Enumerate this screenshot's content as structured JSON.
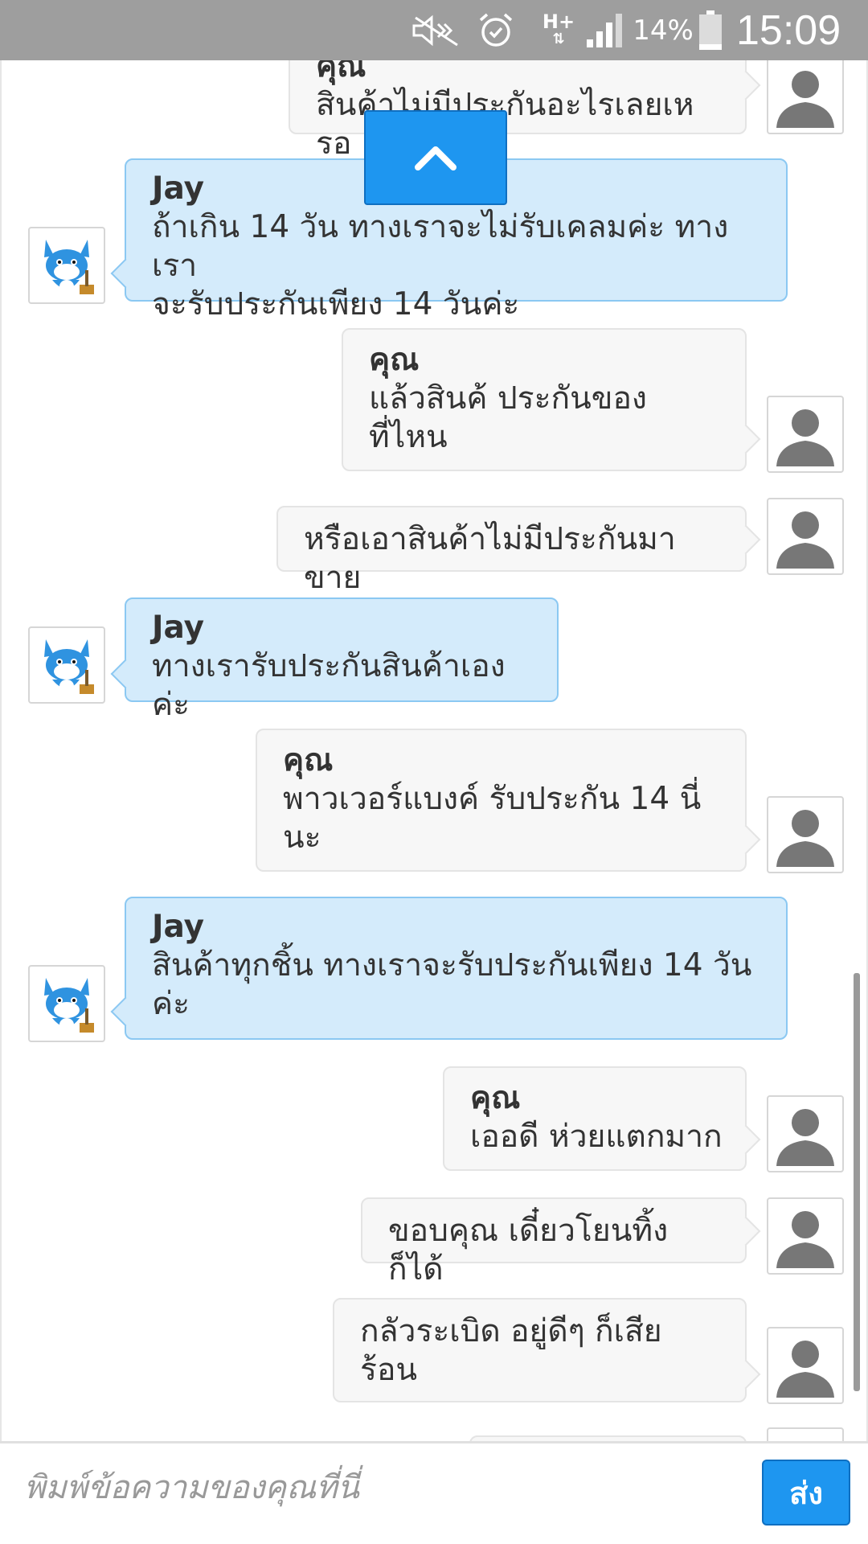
{
  "status_bar": {
    "network": "H+",
    "battery_percent": "14%",
    "time": "15:09",
    "icons": [
      "mute-icon",
      "alarm-icon",
      "network-icon",
      "signal-icon",
      "battery-icon"
    ]
  },
  "chat": {
    "messages": [
      {
        "sender": "คุณ",
        "text": "สินค้าไม่มีประกันอะไรเลยเหรอ",
        "direction": "outgoing"
      },
      {
        "sender": "Jay",
        "text": "ถ้าเกิน 14 วัน ทางเราจะไม่รับเคลมค่ะ ทางเรา\nจะรับประกันเพียง 14 วันค่ะ",
        "direction": "incoming"
      },
      {
        "sender": "คุณ",
        "text": "แล้วสินค้ ประกันของ\nที่ไหน",
        "direction": "outgoing"
      },
      {
        "sender": "",
        "text": "หรือเอาสินค้าไม่มีประกันมาขาย",
        "direction": "outgoing"
      },
      {
        "sender": "Jay",
        "text": "ทางเรารับประกันสินค้าเองค่ะ",
        "direction": "incoming"
      },
      {
        "sender": "คุณ",
        "text": "พาวเวอร์แบงค์ รับประกัน 14 นี่\nนะ",
        "direction": "outgoing"
      },
      {
        "sender": "Jay",
        "text": "สินค้าทุกชิ้น ทางเราจะรับประกันเพียง 14 วัน\nค่ะ",
        "direction": "incoming"
      },
      {
        "sender": "คุณ",
        "text": "เออดี ห่วยแตกมาก",
        "direction": "outgoing"
      },
      {
        "sender": "",
        "text": "ขอบคุณ เดี๋ยวโยนทิ้งก็ได้",
        "direction": "outgoing"
      },
      {
        "sender": "",
        "text": "กลัวระเบิด อยู่ดีๆ ก็เสีย\nร้อน",
        "direction": "outgoing"
      }
    ],
    "scroll_up_icon": "chevron-up-icon",
    "user_avatar_icon": "user-silhouette-icon",
    "agent_avatar_icon": "blue-cat-mascot-icon"
  },
  "composer": {
    "placeholder": "พิมพ์ข้อความของคุณที่นี่",
    "value": "",
    "send_label": "ส่ง"
  },
  "colors": {
    "status_bar": "#9e9e9e",
    "incoming_bubble": "#d4ebfb",
    "incoming_border": "#8bc8f2",
    "outgoing_bubble": "#f7f7f7",
    "accent": "#1e96f0"
  }
}
